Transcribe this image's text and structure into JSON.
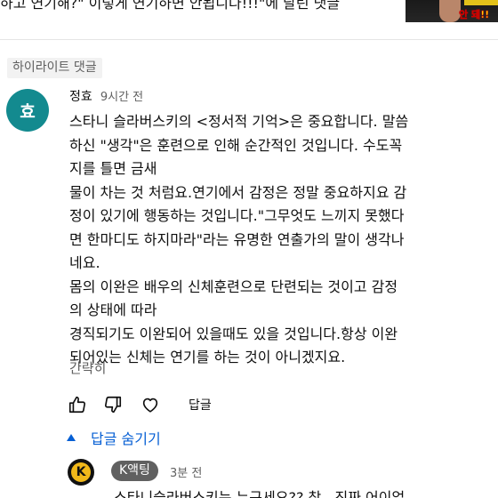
{
  "top": {
    "snippet": "하고 연기해?\" 이렇게 연기하면 안됩니다!!!\"에 달린 댓글"
  },
  "thumbnail": {
    "text": "안 돼!!"
  },
  "highlight": {
    "label": "하이라이트 댓글"
  },
  "comment": {
    "avatar_letter": "효",
    "author": "정효",
    "time": "9시간 전",
    "lines": [
      "스타니 슬라버스키의 <정서적 기억>은 중요합니다. 말씀",
      "하신 \"생각\"은 훈련으로 인해 순간적인 것입니다. 수도꼭",
      "지를 틀면 금새",
      "물이 차는 것 처럼요.연기에서 감정은 정말 중요하지요 감",
      "정이 있기에 행동하는 것입니다.\"그무엇도 느끼지 못했다",
      "면 한마디도 하지마라\"라는 유명한 연출가의 말이 생각나",
      "네요.",
      "몸의 이완은 배우의 신체훈련으로 단련되는 것이고 감정",
      "의 상태에 따라",
      "경직되기도 이완되어 있을때도 있을 것입니다.항상 이완",
      "되어있는 신체는 연기를 하는 것이 아니겠지요."
    ],
    "read_less": "간략히",
    "reply_label": "답글",
    "hide_replies": "답글 숨기기"
  },
  "reply": {
    "avatar_letter": "K",
    "author": "K액팅",
    "time": "3분 전",
    "snippet": "스타니슬라버스키는 누구세요?? 참.. 진짜 어이없"
  },
  "icons": {
    "like": "thumbs-up-icon",
    "dislike": "thumbs-down-icon",
    "heart": "heart-icon",
    "chevron": "chevron-up-icon"
  },
  "colors": {
    "link_blue": "#065fd4",
    "avatar_teal": "#138a8f",
    "chip_gray": "#606060"
  }
}
